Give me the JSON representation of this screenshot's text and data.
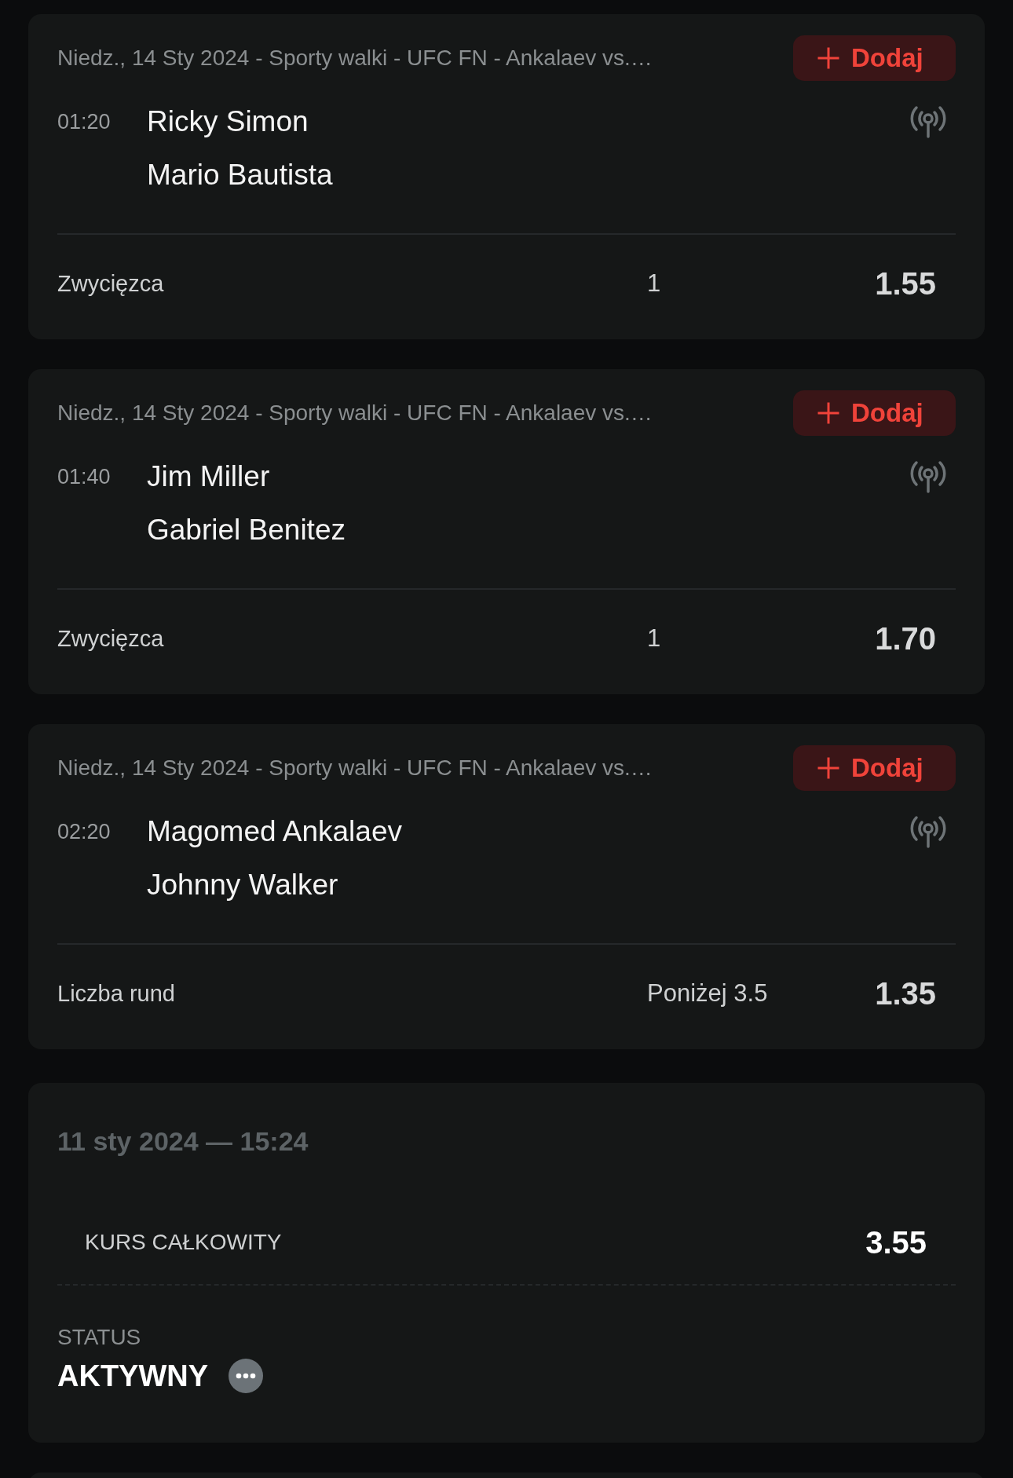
{
  "bets": [
    {
      "event": "Niedz., 14 Sty 2024 - Sporty walki - UFC FN - Ankalaev vs.…",
      "add_button": "Dodaj",
      "time": "01:20",
      "fighters": [
        "Ricky Simon",
        "Mario Bautista"
      ],
      "market": "Zwycięzca",
      "selection": "1",
      "odds": "1.55"
    },
    {
      "event": "Niedz., 14 Sty 2024 - Sporty walki - UFC FN - Ankalaev vs.…",
      "add_button": "Dodaj",
      "time": "01:40",
      "fighters": [
        "Jim Miller",
        "Gabriel Benitez"
      ],
      "market": "Zwycięzca",
      "selection": "1",
      "odds": "1.70"
    },
    {
      "event": "Niedz., 14 Sty 2024 - Sporty walki - UFC FN - Ankalaev vs.…",
      "add_button": "Dodaj",
      "time": "02:20",
      "fighters": [
        "Magomed Ankalaev",
        "Johnny Walker"
      ],
      "market": "Liczba rund",
      "selection": "Poniżej 3.5",
      "odds": "1.35"
    }
  ],
  "summary": {
    "date": "11 sty 2024 — 15:24",
    "total_odds_label": "KURS CAŁKOWITY",
    "total_odds": "3.55",
    "status_label": "STATUS",
    "status": "AKTYWNY"
  }
}
